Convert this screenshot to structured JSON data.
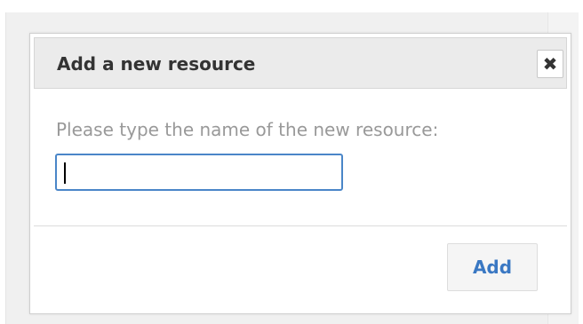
{
  "dialog": {
    "title": "Add a new resource",
    "close_icon": "close-icon",
    "close_glyph": "✖",
    "prompt": "Please type the name of the new resource:",
    "input": {
      "value": "",
      "placeholder": ""
    },
    "add_label": "Add"
  },
  "colors": {
    "accent": "#3a78c3",
    "input_border": "#4a86c8",
    "header_bg": "#ebebeb",
    "prompt_text": "#999999"
  }
}
